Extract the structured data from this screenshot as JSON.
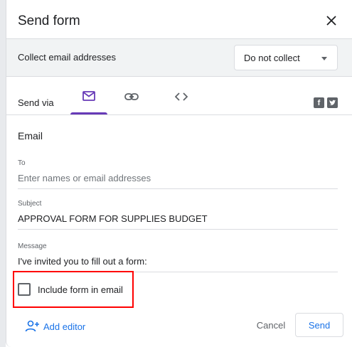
{
  "dialog": {
    "title": "Send form",
    "close_icon": "close-icon"
  },
  "collect": {
    "label": "Collect email addresses",
    "selected_option": "Do not collect"
  },
  "send_via": {
    "label": "Send via",
    "tabs": [
      {
        "icon": "email-icon",
        "active": true
      },
      {
        "icon": "link-icon",
        "active": false
      },
      {
        "icon": "embed-code-icon",
        "active": false
      }
    ],
    "social": {
      "facebook_glyph": "f",
      "twitter_icon": "twitter-icon"
    }
  },
  "email": {
    "section_title": "Email",
    "to_label": "To",
    "to_placeholder": "Enter names or email addresses",
    "subject_label": "Subject",
    "subject_value": "APPROVAL FORM FOR SUPPLIES BUDGET",
    "message_label": "Message",
    "message_value": "I've invited you to fill out a form:",
    "include_form_label": "Include form in email",
    "include_form_checked": false
  },
  "footer": {
    "add_editor_label": "Add editor",
    "cancel_label": "Cancel",
    "send_label": "Send"
  },
  "colors": {
    "accent_purple": "#673ab7",
    "link_blue": "#1a73e8",
    "highlight_red": "#ff0000"
  }
}
